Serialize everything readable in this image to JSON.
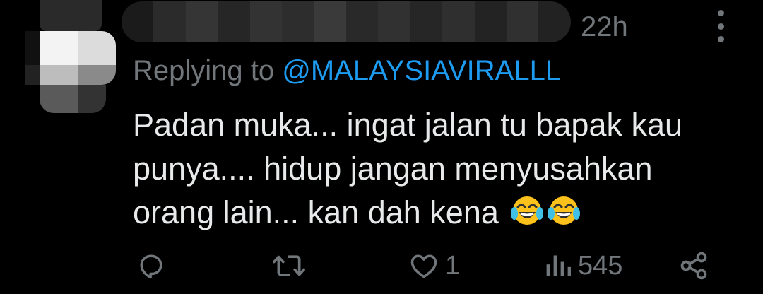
{
  "tweet": {
    "time": "22h",
    "replying_prefix": "Replying to ",
    "replying_handle": "@MALAYSIAVIRALLL",
    "body_lines": [
      "Padan muka... ingat jalan tu bapak kau",
      "punya.... hidup jangan menyusahkan",
      "orang lain... kan dah kena"
    ],
    "emoji": [
      "face-with-tears-of-joy",
      "face-with-tears-of-joy"
    ]
  },
  "actions": {
    "reply_count": "",
    "retweet_count": "",
    "like_count": "1",
    "views_count": "545"
  },
  "colors": {
    "background": "#000000",
    "text": "#e7e9ea",
    "secondary": "#71767b",
    "link": "#1d9bf0"
  }
}
